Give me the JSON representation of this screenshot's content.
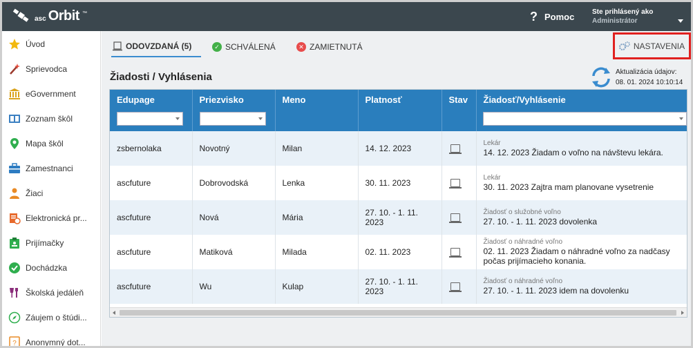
{
  "app": {
    "logo_prefix": "asc",
    "logo_name": "Orbit",
    "logo_tm": "™",
    "help_label": "Pomoc",
    "help_symbol": "?",
    "user_line1": "Ste prihlásený ako",
    "user_line2": "Administrátor"
  },
  "sidebar": {
    "items": [
      {
        "label": "Úvod",
        "icon": "star-icon",
        "color": "#f2b90f"
      },
      {
        "label": "Sprievodca",
        "icon": "magic-wand-icon",
        "color": "#e54b3b"
      },
      {
        "label": "eGovernment",
        "icon": "institution-icon",
        "color": "#d9a21b"
      },
      {
        "label": "Zoznam škôl",
        "icon": "school-list-icon",
        "color": "#3a7fc1"
      },
      {
        "label": "Mapa škôl",
        "icon": "map-pin-icon",
        "color": "#2fae4e"
      },
      {
        "label": "Zamestnanci",
        "icon": "briefcase-icon",
        "color": "#2d7cc2"
      },
      {
        "label": "Žiaci",
        "icon": "student-icon",
        "color": "#e98a25"
      },
      {
        "label": "Elektronická pr...",
        "icon": "application-icon",
        "color": "#e76a2c"
      },
      {
        "label": "Prijímačky",
        "icon": "admission-icon",
        "color": "#2fae4e"
      },
      {
        "label": "Dochádzka",
        "icon": "attendance-check-icon",
        "color": "#2fae4e"
      },
      {
        "label": "Školská jedáleň",
        "icon": "canteen-icon",
        "color": "#8a2d7a"
      },
      {
        "label": "Záujem o štúdi...",
        "icon": "compass-icon",
        "color": "#2fae4e"
      },
      {
        "label": "Anonymný dot...",
        "icon": "anonymous-survey-icon",
        "color": "#e98a25"
      }
    ]
  },
  "tabs": [
    {
      "label": "ODOVZDANÁ (5)",
      "icon": "document-icon"
    },
    {
      "label": "SCHVÁLENÁ",
      "icon": "check-circle-icon",
      "color": "#43b049"
    },
    {
      "label": "ZAMIETNUTÁ",
      "icon": "x-circle-icon",
      "color": "#e84c4c"
    }
  ],
  "settings_label": "NASTAVENIA",
  "section_title": "Žiadosti / Vyhlásenia",
  "update": {
    "label": "Aktualizácia údajov:",
    "value": "08. 01. 2024 10:10:14"
  },
  "table": {
    "columns": [
      "Edupage",
      "Priezvisko",
      "Meno",
      "Platnosť",
      "Stav",
      "Žiadosť/Vyhlásenie"
    ],
    "rows": [
      {
        "edupage": "zsbernolaka",
        "surname": "Novotný",
        "name": "Milan",
        "validity": "14. 12. 2023",
        "type": "Lekár",
        "text": "14. 12. 2023 Žiadam o voľno na návštevu lekára."
      },
      {
        "edupage": "ascfuture",
        "surname": "Dobrovodská",
        "name": "Lenka",
        "validity": "30. 11. 2023",
        "type": "Lekár",
        "text": "30. 11. 2023 Zajtra mam planovane vysetrenie"
      },
      {
        "edupage": "ascfuture",
        "surname": "Nová",
        "name": "Mária",
        "validity": "27. 10. - 1. 11. 2023",
        "type": "Žiadosť o služobné voľno",
        "text": "27. 10. - 1. 11. 2023 dovolenka"
      },
      {
        "edupage": "ascfuture",
        "surname": "Matiková",
        "name": "Milada",
        "validity": "02. 11. 2023",
        "type": "Žiadosť o náhradné voľno",
        "text": "02. 11. 2023 Žiadam o náhradné voľno za nadčasy počas prijímacieho konania."
      },
      {
        "edupage": "ascfuture",
        "surname": "Wu",
        "name": "Kulap",
        "validity": "27. 10. - 1. 11. 2023",
        "type": "Žiadosť o náhradné voľno",
        "text": "27. 10. - 1. 11. 2023 idem na dovolenku"
      }
    ]
  }
}
